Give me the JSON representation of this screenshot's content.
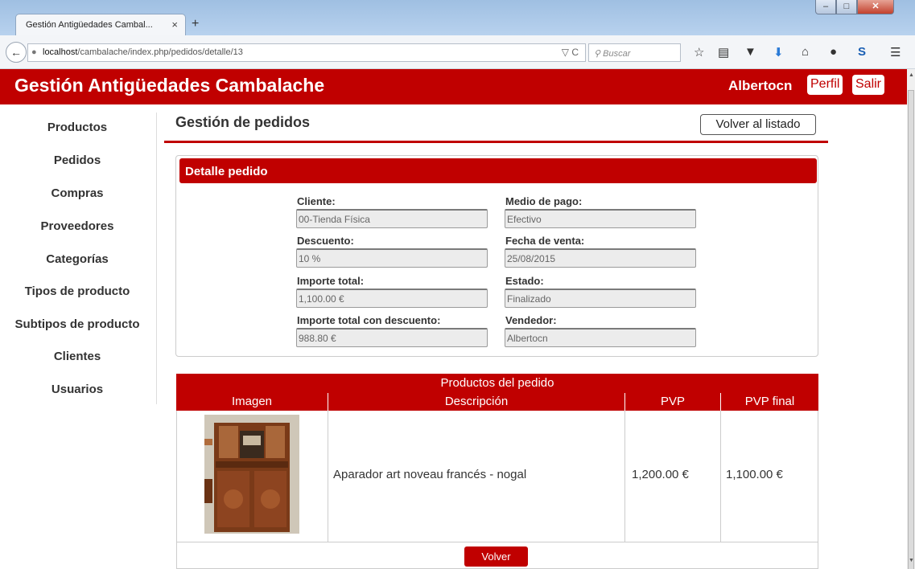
{
  "browser": {
    "tab_title": "Gestión Antigüedades Cambal...",
    "tab_close": "×",
    "new_tab": "+",
    "url_host": "localhost",
    "url_path": "/cambalache/index.php/pedidos/detalle/13",
    "search_placeholder": "Buscar",
    "window_controls": {
      "minimize": "–",
      "maximize": "□",
      "close": "✕"
    }
  },
  "header": {
    "site_title": "Gestión Antigüedades Cambalache",
    "user": "Albertocn",
    "profile_label": "Perfil",
    "logout_label": "Salir"
  },
  "sidebar": {
    "items": [
      {
        "label": "Productos"
      },
      {
        "label": "Pedidos"
      },
      {
        "label": "Compras"
      },
      {
        "label": "Proveedores"
      },
      {
        "label": "Categorías"
      },
      {
        "label": "Tipos de producto"
      },
      {
        "label": "Subtipos de producto"
      },
      {
        "label": "Clientes"
      },
      {
        "label": "Usuarios"
      }
    ]
  },
  "main": {
    "title": "Gestión de pedidos",
    "back_to_list": "Volver al listado",
    "detail": {
      "heading": "Detalle pedido",
      "fields": {
        "cliente": {
          "label": "Cliente:",
          "value": "00-Tienda Física"
        },
        "medio_pago": {
          "label": "Medio de pago:",
          "value": "Efectivo"
        },
        "descuento": {
          "label": "Descuento:",
          "value": "10 %"
        },
        "fecha_venta": {
          "label": "Fecha de venta:",
          "value": "25/08/2015"
        },
        "importe_total": {
          "label": "Importe total:",
          "value": "1,100.00 €"
        },
        "estado": {
          "label": "Estado:",
          "value": "Finalizado"
        },
        "importe_desc": {
          "label": "Importe total con descuento:",
          "value": "988.80 €"
        },
        "vendedor": {
          "label": "Vendedor:",
          "value": "Albertocn"
        }
      }
    },
    "products": {
      "caption": "Productos del pedido",
      "columns": [
        "Imagen",
        "Descripción",
        "PVP",
        "PVP final"
      ],
      "rows": [
        {
          "descripcion": "Aparador art noveau francés - nogal",
          "pvp": "1,200.00 €",
          "pvp_final": "1,100.00 €"
        }
      ]
    },
    "volver": "Volver"
  }
}
